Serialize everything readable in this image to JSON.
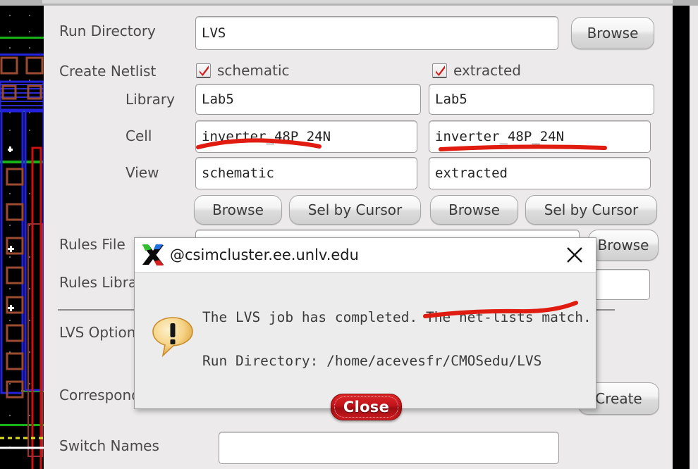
{
  "window": {
    "background_app": "layout-editor",
    "panel_bg": "#eceaea"
  },
  "form": {
    "run_directory": {
      "label": "Run Directory",
      "value": "LVS",
      "browse_label": "Browse"
    },
    "create_netlist": {
      "label": "Create Netlist",
      "schematic_checkbox_label": "schematic",
      "schematic_checked": true,
      "extracted_checkbox_label": "extracted",
      "extracted_checked": true
    },
    "library": {
      "label": "Library",
      "schematic_value": "Lab5",
      "extracted_value": "Lab5"
    },
    "cell": {
      "label": "Cell",
      "schematic_value": "inverter_48P_24N",
      "extracted_value": "inverter_48P_24N"
    },
    "view": {
      "label": "View",
      "schematic_value": "schematic",
      "extracted_value": "extracted"
    },
    "netlist_buttons": {
      "browse_label": "Browse",
      "sel_by_cursor_label": "Sel by Cursor"
    },
    "rules_file": {
      "label": "Rules File",
      "value": "",
      "browse_label": "Browse"
    },
    "rules_library": {
      "label": "Rules Library",
      "value": ""
    },
    "lvs_options": {
      "label": "LVS Options"
    },
    "correspondence": {
      "label": "Correspondence File",
      "create_label": "Create"
    },
    "switch_names": {
      "label": "Switch Names",
      "value": ""
    }
  },
  "dialog": {
    "title": "@csimcluster.ee.unlv.edu",
    "close_x_icon": "close-icon",
    "xorg_icon": "xorg-logo-icon",
    "warning_icon": "speech-bubble-exclamation-icon",
    "message_line1": "The LVS job has completed. The net-lists match.",
    "message_line2": "Run Directory: /home/acevesfr/CMOSedu/LVS",
    "close_button_label": "Close",
    "close_button_color": "#c0131b"
  },
  "annotations": {
    "marker_color": "#e01b10",
    "underline_cell_schematic": "inverter_48P_24N",
    "underline_cell_extracted": "inverter_48P_24N",
    "underline_message": "The net-lists match."
  }
}
